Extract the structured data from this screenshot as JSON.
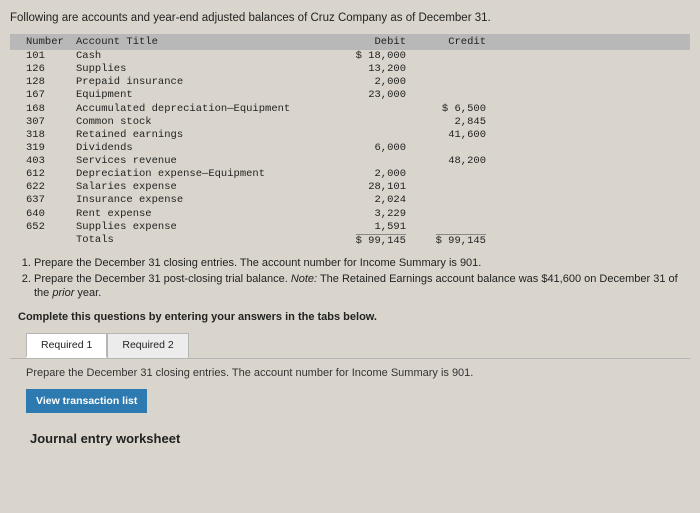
{
  "intro": "Following are accounts and year-end adjusted balances of Cruz Company as of December 31.",
  "headers": {
    "number": "Number",
    "title": "Account Title",
    "debit": "Debit",
    "credit": "Credit"
  },
  "rows": [
    {
      "num": "101",
      "title": "Cash",
      "debit": "$ 18,000",
      "credit": ""
    },
    {
      "num": "126",
      "title": "Supplies",
      "debit": "13,200",
      "credit": ""
    },
    {
      "num": "128",
      "title": "Prepaid insurance",
      "debit": "2,000",
      "credit": ""
    },
    {
      "num": "167",
      "title": "Equipment",
      "debit": "23,000",
      "credit": ""
    },
    {
      "num": "168",
      "title": "Accumulated depreciation—Equipment",
      "debit": "",
      "credit": "$ 6,500"
    },
    {
      "num": "307",
      "title": "Common stock",
      "debit": "",
      "credit": "2,845"
    },
    {
      "num": "318",
      "title": "Retained earnings",
      "debit": "",
      "credit": "41,600"
    },
    {
      "num": "319",
      "title": "Dividends",
      "debit": "6,000",
      "credit": ""
    },
    {
      "num": "403",
      "title": "Services revenue",
      "debit": "",
      "credit": "48,200"
    },
    {
      "num": "612",
      "title": "Depreciation expense—Equipment",
      "debit": "2,000",
      "credit": ""
    },
    {
      "num": "622",
      "title": "Salaries expense",
      "debit": "28,101",
      "credit": ""
    },
    {
      "num": "637",
      "title": "Insurance expense",
      "debit": "2,024",
      "credit": ""
    },
    {
      "num": "640",
      "title": "Rent expense",
      "debit": "3,229",
      "credit": ""
    },
    {
      "num": "652",
      "title": "Supplies expense",
      "debit": "1,591",
      "credit": ""
    }
  ],
  "totals": {
    "label": "Totals",
    "debit": "$ 99,145",
    "credit": "$ 99,145"
  },
  "instructions": {
    "item1": "Prepare the December 31 closing entries. The account number for Income Summary is 901.",
    "item2_prefix": "Prepare the December 31 post-closing trial balance. ",
    "item2_note_label": "Note:",
    "item2_note_text": " The Retained Earnings account balance was $41,600 on December 31 of the ",
    "item2_em": "prior",
    "item2_suffix": " year."
  },
  "complete_hint": "Complete this questions by entering your answers in the tabs below.",
  "tabs": {
    "req1": "Required 1",
    "req2": "Required 2"
  },
  "tab_instruction": "Prepare the December 31 closing entries. The account number for Income Summary is 901.",
  "btn_view": "View transaction list",
  "worksheet_title": "Journal entry worksheet"
}
